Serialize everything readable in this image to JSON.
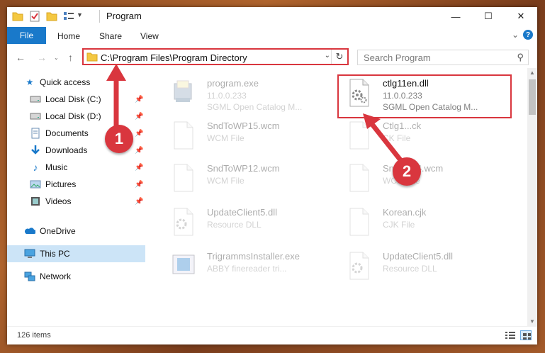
{
  "window": {
    "title": "Program",
    "minimize": "—",
    "maximize": "☐",
    "close": "✕"
  },
  "ribbon": {
    "tabs": [
      "File",
      "Home",
      "Share",
      "View"
    ],
    "expand_glyph": "⌄",
    "help_glyph": "?"
  },
  "address_bar": {
    "path": "C:\\Program Files\\Program Directory",
    "search_placeholder": "Search Program"
  },
  "sidebar": {
    "items": [
      {
        "label": "Quick access",
        "icon": "star-icon",
        "pinned": false
      },
      {
        "label": "Local Disk (C:)",
        "icon": "drive-icon",
        "pinned": true
      },
      {
        "label": "Local Disk (D:)",
        "icon": "drive-icon",
        "pinned": true
      },
      {
        "label": "Documents",
        "icon": "documents-icon",
        "pinned": true
      },
      {
        "label": "Downloads",
        "icon": "download-icon",
        "pinned": true
      },
      {
        "label": "Music",
        "icon": "music-icon",
        "pinned": true
      },
      {
        "label": "Pictures",
        "icon": "pictures-icon",
        "pinned": true
      },
      {
        "label": "Videos",
        "icon": "videos-icon",
        "pinned": true
      },
      {
        "label": "OneDrive",
        "icon": "cloud-icon",
        "pinned": false
      },
      {
        "label": "This PC",
        "icon": "computer-icon",
        "pinned": false,
        "selected": true
      },
      {
        "label": "Network",
        "icon": "network-icon",
        "pinned": false
      }
    ]
  },
  "files": [
    {
      "name": "program.exe",
      "line2": "11.0.0.233",
      "line3": "SGML Open Catalog M...",
      "icon": "exe-installer-icon",
      "faded": true
    },
    {
      "name": "ctlg11en.dll",
      "line2": "11.0.0.233",
      "line3": "SGML Open Catalog M...",
      "icon": "dll-gear-icon",
      "faded": false,
      "highlighted": true
    },
    {
      "name": "SndToWP15.wcm",
      "line2": "WCM File",
      "line3": "",
      "icon": "blank-file-icon",
      "faded": true
    },
    {
      "name": "Ctlg1...ck",
      "line2": "CK File",
      "line3": "",
      "icon": "blank-file-icon",
      "faded": true
    },
    {
      "name": "SndToWP12.wcm",
      "line2": "WCM File",
      "line3": "",
      "icon": "blank-file-icon",
      "faded": true
    },
    {
      "name": "SndT...14.wcm",
      "line2": "WCM File",
      "line3": "",
      "icon": "blank-file-icon",
      "faded": true
    },
    {
      "name": "UpdateClient5.dll",
      "line2": "Resource DLL",
      "line3": "",
      "icon": "dll-gear-icon",
      "faded": true
    },
    {
      "name": "Korean.cjk",
      "line2": "CJK File",
      "line3": "",
      "icon": "blank-file-icon",
      "faded": true
    },
    {
      "name": "TrigrammsInstaller.exe",
      "line2": "ABBY finereader tri...",
      "line3": "",
      "icon": "exe-app-icon",
      "faded": true
    },
    {
      "name": "UpdateClient5.dll",
      "line2": "Resource DLL",
      "line3": "",
      "icon": "dll-gear-icon",
      "faded": true
    }
  ],
  "status": {
    "item_count": "126 items"
  },
  "annotations": {
    "badge1": "1",
    "badge2": "2",
    "color": "#d9363e"
  },
  "colors": {
    "accent": "#1979ca",
    "selection": "#cce4f7",
    "highlight_border": "#d9363e"
  }
}
